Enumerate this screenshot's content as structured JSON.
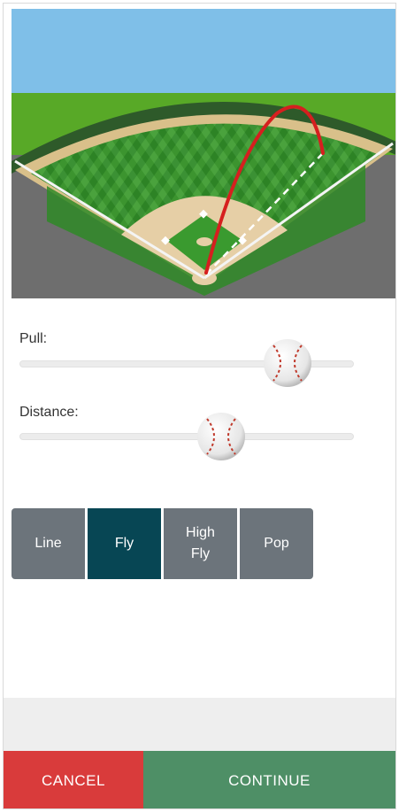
{
  "field": {
    "colors": {
      "sky": "#7fbfe8",
      "grass": "#3a9a2f",
      "wall": "#2e5a2a",
      "warning_track": "#d9c08a",
      "infield_dirt": "#e6cfa6",
      "foul_territory": "#6e6e6e",
      "trajectory": "#d61f1f"
    }
  },
  "sliders": {
    "pull": {
      "label": "Pull:",
      "value_fraction": 0.81
    },
    "distance": {
      "label": "Distance:",
      "value_fraction": 0.6
    }
  },
  "hit_types": [
    {
      "label": "Line",
      "active": false
    },
    {
      "label": "Fly",
      "active": true
    },
    {
      "label": "High\nFly",
      "active": false
    },
    {
      "label": "Pop",
      "active": false
    }
  ],
  "actions": {
    "cancel": "CANCEL",
    "continue": "CONTINUE"
  },
  "colors": {
    "active_type": "#074654",
    "inactive_type": "#6c747b",
    "cancel": "#d93b3b",
    "continue": "#4e8f66"
  }
}
